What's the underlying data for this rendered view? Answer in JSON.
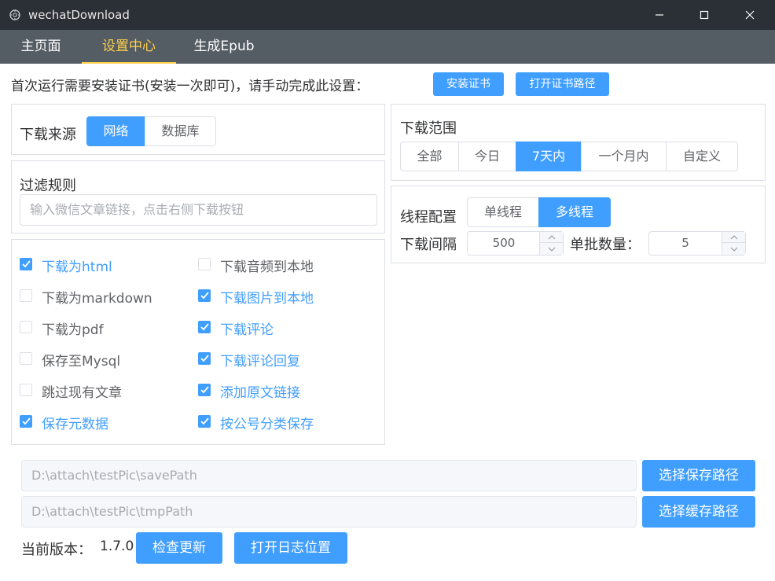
{
  "window": {
    "title": "wechatDownload",
    "minimize_icon": "minimize-icon",
    "maximize_icon": "maximize-icon",
    "close_icon": "close-icon"
  },
  "tabs": [
    {
      "label": "主页面",
      "active": false
    },
    {
      "label": "设置中心",
      "active": true
    },
    {
      "label": "生成Epub",
      "active": false
    }
  ],
  "cert": {
    "text": "首次运行需要安装证书(安装一次即可)，请手动完成此设置：",
    "install_button": "安装证书",
    "open_path_button": "打开证书路径"
  },
  "source": {
    "label": "下载来源",
    "options": [
      "网络",
      "数据库"
    ],
    "selected": "网络"
  },
  "filter": {
    "label": "过滤规则",
    "placeholder": "输入微信文章链接，点击右侧下载按钮"
  },
  "options_left": [
    {
      "label": "下载为html",
      "checked": true
    },
    {
      "label": "下载为markdown",
      "checked": false
    },
    {
      "label": "下载为pdf",
      "checked": false
    },
    {
      "label": "保存至Mysql",
      "checked": false
    },
    {
      "label": "跳过现有文章",
      "checked": false
    },
    {
      "label": "保存元数据",
      "checked": true
    }
  ],
  "options_right": [
    {
      "label": "下载音频到本地",
      "checked": false
    },
    {
      "label": "下载图片到本地",
      "checked": true
    },
    {
      "label": "下载评论",
      "checked": true
    },
    {
      "label": "下载评论回复",
      "checked": true
    },
    {
      "label": "添加原文链接",
      "checked": true
    },
    {
      "label": "按公号分类保存",
      "checked": true
    }
  ],
  "range": {
    "label": "下载范围",
    "options": [
      "全部",
      "今日",
      "7天内",
      "一个月内",
      "自定义"
    ],
    "selected": "7天内"
  },
  "thread": {
    "label": "线程配置",
    "options": [
      "单线程",
      "多线程"
    ],
    "selected": "多线程",
    "interval_label": "下载间隔",
    "interval_value": "500",
    "batch_label": "单批数量：",
    "batch_value": "5"
  },
  "paths": {
    "save_path": "D:\\attach\\testPic\\savePath",
    "save_button": "选择保存路径",
    "tmp_path": "D:\\attach\\testPic\\tmpPath",
    "tmp_button": "选择缓存路径"
  },
  "footer": {
    "version_label": "当前版本：",
    "version_value": "1.7.0",
    "check_update_button": "检查更新",
    "open_log_button": "打开日志位置"
  },
  "colors": {
    "primary": "#409eff",
    "active_tab": "#ffd04b",
    "tabbar": "#545c64",
    "titlebar": "#2b2f36"
  }
}
